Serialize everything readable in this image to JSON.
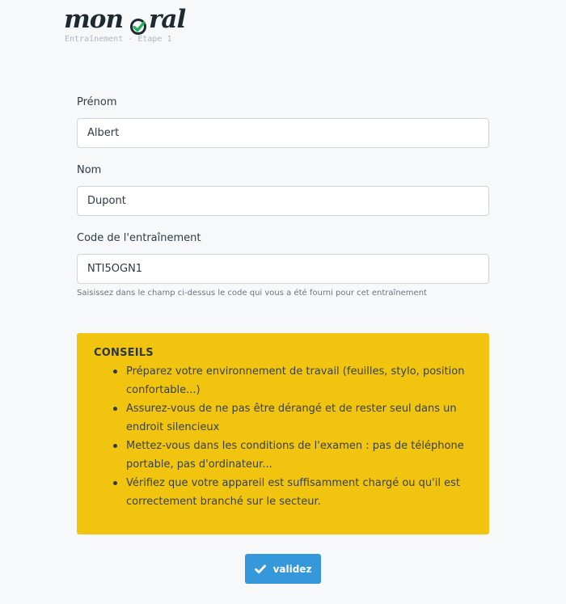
{
  "header": {
    "logo_text_left": "mon",
    "logo_text_right": "ral",
    "subtitle": "Entraînement - Étape 1"
  },
  "form": {
    "first_name": {
      "label": "Prénom",
      "value": "Albert"
    },
    "last_name": {
      "label": "Nom",
      "value": "Dupont"
    },
    "code": {
      "label": "Code de l'entraînement",
      "value": "NTI5OGN1",
      "help": "Saisissez dans le champ ci-dessus le code qui vous a été fourni pour cet entraînement"
    }
  },
  "advice": {
    "title": "CONSEILS",
    "items": [
      "Préparez votre environnement de travail (feuilles, stylo, position confortable...)",
      "Assurez-vous de ne pas être dérangé et de rester seul dans un endroit silencieux",
      "Mettez-vous dans les conditions de l'examen : pas de téléphone portable, pas d'ordinateur...",
      "Vérifiez que votre appareil est suffisamment chargé ou qu'il est correctement branché sur le secteur."
    ]
  },
  "submit": {
    "label": "validez",
    "icon": "check-icon"
  },
  "colors": {
    "advice_background": "#f1c40f",
    "button_background": "#3498db",
    "logo_check": "#27ae60"
  }
}
